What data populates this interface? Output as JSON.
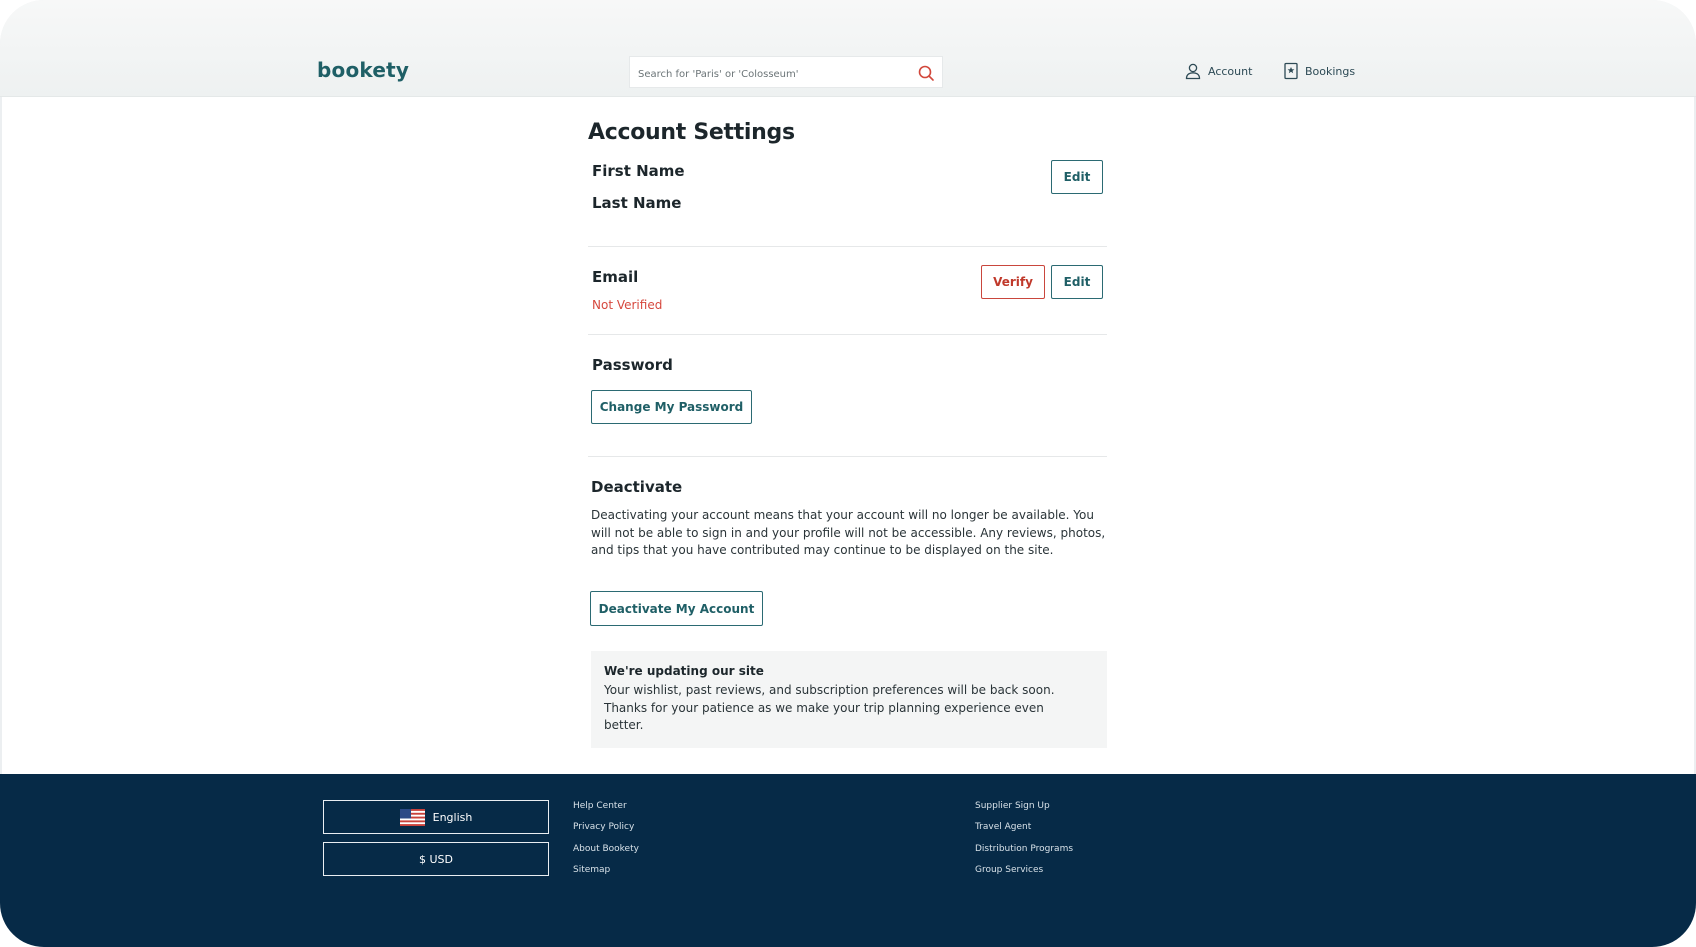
{
  "header": {
    "logo": "bookety",
    "search_placeholder": "Search for 'Paris' or 'Colosseum'",
    "nav": {
      "account": "Account",
      "bookings": "Bookings"
    }
  },
  "main": {
    "title": "Account Settings",
    "name_section": {
      "first_name_label": "First Name",
      "last_name_label": "Last Name",
      "edit_label": "Edit"
    },
    "email_section": {
      "label": "Email",
      "status": "Not Verified",
      "verify_label": "Verify",
      "edit_label": "Edit"
    },
    "password_section": {
      "label": "Password",
      "button_label": "Change My Password"
    },
    "deactivate_section": {
      "label": "Deactivate",
      "description": "Deactivating your account means that your account will no longer be available. You will not be able to sign in and your profile will not be accessible. Any reviews, photos, and tips that you have contributed may continue to be displayed on the site.",
      "button_label": "Deactivate My Account"
    },
    "notice": {
      "title": "We're updating our site",
      "body": "Your wishlist, past reviews, and subscription preferences will be back soon. Thanks for your patience as we make your trip planning experience even better."
    }
  },
  "footer": {
    "language": "English",
    "currency": "$ USD",
    "links_col1": [
      "Help Center",
      "Privacy Policy",
      "About Bookety",
      "Sitemap"
    ],
    "links_col2": [
      "Supplier Sign Up",
      "Travel Agent",
      "Distribution Programs",
      "Group Services"
    ]
  },
  "colors": {
    "brand": "#1f5f66",
    "alert": "#d6483e",
    "footer_bg": "#062a47"
  },
  "icons": {
    "search": "search-icon",
    "account": "user-icon",
    "bookings": "bookings-icon",
    "flag": "us-flag-icon"
  }
}
